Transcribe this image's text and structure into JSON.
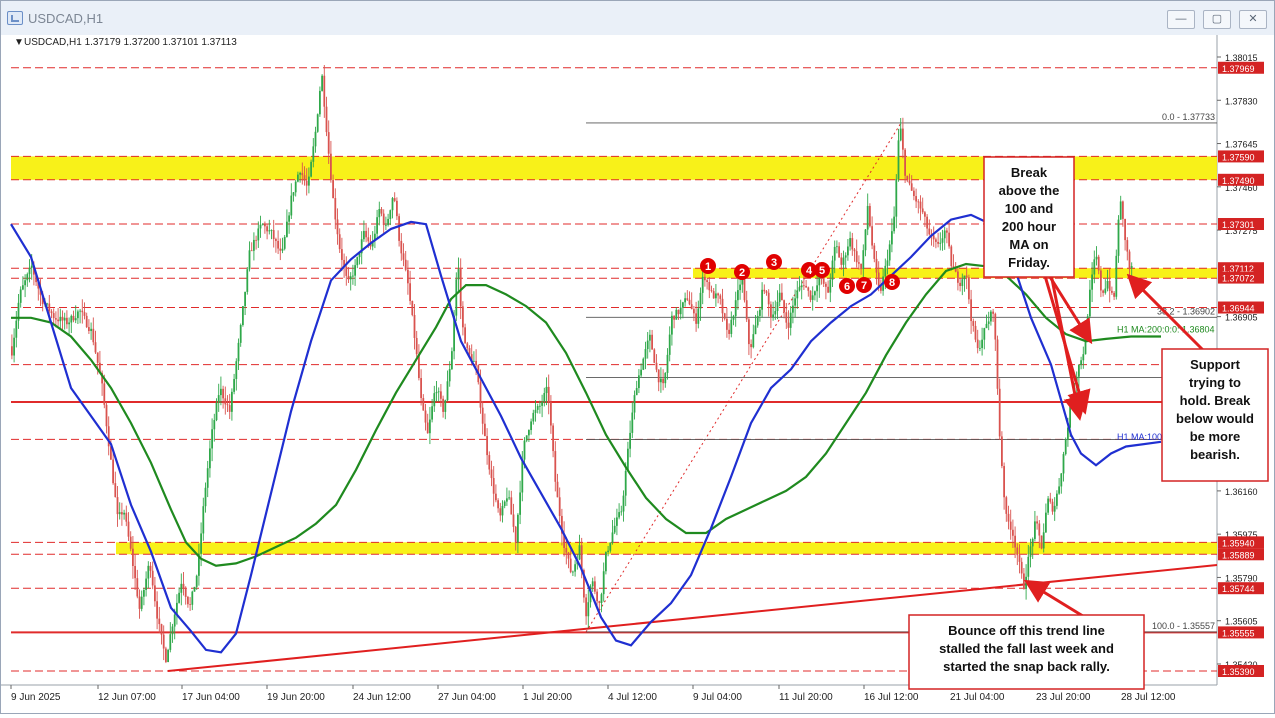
{
  "window": {
    "title": "USDCAD,H1",
    "buttons": {
      "minimize": "—",
      "restore": "▢",
      "close": "✕"
    }
  },
  "chart_data": {
    "type": "candlestick",
    "symbol_header": "USDCAD,H1  1.37179 1.37200 1.37101 1.37113",
    "ylim": [
      1.3539,
      1.38015
    ],
    "price_ticks": [
      "1.38015",
      "1.37830",
      "1.37645",
      "1.37460",
      "1.37275",
      "1.36905",
      "1.36160",
      "1.35975",
      "1.35790",
      "1.35605",
      "1.35420"
    ],
    "x_ticks": [
      "9 Jun 2025",
      "12 Jun 07:00",
      "17 Jun 04:00",
      "19 Jun 20:00",
      "24 Jun 12:00",
      "27 Jun 04:00",
      "1 Jul 20:00",
      "4 Jul 12:00",
      "9 Jul 04:00",
      "11 Jul 20:00",
      "16 Jul 12:00",
      "21 Jul 04:00",
      "23 Jul 20:00",
      "28 Jul 12:00"
    ],
    "price_path": [
      [
        0,
        1.3692
      ],
      [
        12,
        1.3675
      ],
      [
        20,
        1.37
      ],
      [
        32,
        1.3712
      ],
      [
        42,
        1.3698
      ],
      [
        55,
        1.369
      ],
      [
        68,
        1.3688
      ],
      [
        80,
        1.3693
      ],
      [
        92,
        1.3684
      ],
      [
        102,
        1.3662
      ],
      [
        110,
        1.3633
      ],
      [
        118,
        1.3604
      ],
      [
        124,
        1.3608
      ],
      [
        132,
        1.3588
      ],
      [
        140,
        1.3565
      ],
      [
        150,
        1.3586
      ],
      [
        158,
        1.3561
      ],
      [
        166,
        1.3544
      ],
      [
        174,
        1.3562
      ],
      [
        182,
        1.3578
      ],
      [
        190,
        1.3566
      ],
      [
        198,
        1.3582
      ],
      [
        205,
        1.3615
      ],
      [
        212,
        1.364
      ],
      [
        220,
        1.366
      ],
      [
        230,
        1.365
      ],
      [
        240,
        1.3682
      ],
      [
        250,
        1.3718
      ],
      [
        262,
        1.373
      ],
      [
        272,
        1.3726
      ],
      [
        282,
        1.3716
      ],
      [
        292,
        1.3742
      ],
      [
        300,
        1.3754
      ],
      [
        308,
        1.3745
      ],
      [
        316,
        1.377
      ],
      [
        322,
        1.3795
      ],
      [
        328,
        1.3765
      ],
      [
        334,
        1.3738
      ],
      [
        340,
        1.372
      ],
      [
        348,
        1.3704
      ],
      [
        356,
        1.3712
      ],
      [
        364,
        1.3726
      ],
      [
        372,
        1.372
      ],
      [
        380,
        1.3737
      ],
      [
        386,
        1.3728
      ],
      [
        394,
        1.3744
      ],
      [
        400,
        1.3722
      ],
      [
        408,
        1.3705
      ],
      [
        416,
        1.3678
      ],
      [
        422,
        1.3652
      ],
      [
        428,
        1.364
      ],
      [
        436,
        1.3661
      ],
      [
        444,
        1.365
      ],
      [
        452,
        1.3675
      ],
      [
        458,
        1.3716
      ],
      [
        462,
        1.3688
      ],
      [
        468,
        1.3675
      ],
      [
        476,
        1.367
      ],
      [
        484,
        1.3642
      ],
      [
        492,
        1.362
      ],
      [
        500,
        1.3604
      ],
      [
        508,
        1.3615
      ],
      [
        516,
        1.3595
      ],
      [
        524,
        1.3635
      ],
      [
        532,
        1.3648
      ],
      [
        540,
        1.3652
      ],
      [
        548,
        1.366
      ],
      [
        556,
        1.3618
      ],
      [
        564,
        1.3594
      ],
      [
        572,
        1.358
      ],
      [
        580,
        1.3592
      ],
      [
        586,
        1.3563
      ],
      [
        592,
        1.3578
      ],
      [
        600,
        1.3567
      ],
      [
        606,
        1.3588
      ],
      [
        614,
        1.36
      ],
      [
        622,
        1.3608
      ],
      [
        630,
        1.364
      ],
      [
        636,
        1.366
      ],
      [
        642,
        1.367
      ],
      [
        650,
        1.3682
      ],
      [
        658,
        1.3665
      ],
      [
        664,
        1.366
      ],
      [
        672,
        1.369
      ],
      [
        680,
        1.3693
      ],
      [
        688,
        1.3699
      ],
      [
        696,
        1.3688
      ],
      [
        704,
        1.3709
      ],
      [
        712,
        1.37
      ],
      [
        720,
        1.3698
      ],
      [
        728,
        1.3682
      ],
      [
        736,
        1.3696
      ],
      [
        742,
        1.3708
      ],
      [
        750,
        1.3676
      ],
      [
        758,
        1.369
      ],
      [
        764,
        1.3704
      ],
      [
        772,
        1.369
      ],
      [
        780,
        1.37
      ],
      [
        788,
        1.3686
      ],
      [
        796,
        1.37
      ],
      [
        804,
        1.3705
      ],
      [
        812,
        1.3698
      ],
      [
        820,
        1.3709
      ],
      [
        828,
        1.37
      ],
      [
        836,
        1.3722
      ],
      [
        842,
        1.3712
      ],
      [
        850,
        1.3724
      ],
      [
        856,
        1.3716
      ],
      [
        862,
        1.371
      ],
      [
        868,
        1.3738
      ],
      [
        874,
        1.3715
      ],
      [
        880,
        1.37
      ],
      [
        886,
        1.3712
      ],
      [
        894,
        1.373
      ],
      [
        900,
        1.3774
      ],
      [
        906,
        1.375
      ],
      [
        914,
        1.3742
      ],
      [
        922,
        1.3736
      ],
      [
        930,
        1.3725
      ],
      [
        938,
        1.372
      ],
      [
        946,
        1.3728
      ],
      [
        952,
        1.3712
      ],
      [
        960,
        1.3705
      ],
      [
        966,
        1.371
      ],
      [
        972,
        1.3688
      ],
      [
        978,
        1.3676
      ],
      [
        986,
        1.3686
      ],
      [
        994,
        1.3694
      ],
      [
        1000,
        1.364
      ],
      [
        1006,
        1.3605
      ],
      [
        1012,
        1.36
      ],
      [
        1018,
        1.3588
      ],
      [
        1024,
        1.3575
      ],
      [
        1030,
        1.359
      ],
      [
        1036,
        1.3603
      ],
      [
        1042,
        1.3592
      ],
      [
        1048,
        1.3612
      ],
      [
        1054,
        1.3608
      ],
      [
        1060,
        1.362
      ],
      [
        1066,
        1.3638
      ],
      [
        1072,
        1.3655
      ],
      [
        1078,
        1.3668
      ],
      [
        1084,
        1.3676
      ],
      [
        1090,
        1.37
      ],
      [
        1096,
        1.3718
      ],
      [
        1102,
        1.37
      ],
      [
        1108,
        1.3706
      ],
      [
        1114,
        1.3696
      ],
      [
        1120,
        1.3742
      ],
      [
        1126,
        1.3722
      ],
      [
        1130,
        1.3711
      ]
    ],
    "ma100_path": [
      [
        10,
        1.373
      ],
      [
        30,
        1.3716
      ],
      [
        50,
        1.3688
      ],
      [
        70,
        1.366
      ],
      [
        90,
        1.3648
      ],
      [
        110,
        1.3636
      ],
      [
        130,
        1.361
      ],
      [
        150,
        1.359
      ],
      [
        170,
        1.3566
      ],
      [
        190,
        1.3556
      ],
      [
        205,
        1.3548
      ],
      [
        220,
        1.3547
      ],
      [
        235,
        1.3555
      ],
      [
        250,
        1.358
      ],
      [
        270,
        1.3615
      ],
      [
        290,
        1.365
      ],
      [
        310,
        1.368
      ],
      [
        330,
        1.3706
      ],
      [
        350,
        1.3715
      ],
      [
        370,
        1.3722
      ],
      [
        390,
        1.3728
      ],
      [
        410,
        1.3731
      ],
      [
        425,
        1.373
      ],
      [
        440,
        1.3708
      ],
      [
        460,
        1.368
      ],
      [
        480,
        1.3664
      ],
      [
        500,
        1.3648
      ],
      [
        520,
        1.363
      ],
      [
        540,
        1.3615
      ],
      [
        560,
        1.36
      ],
      [
        580,
        1.3583
      ],
      [
        600,
        1.3562
      ],
      [
        615,
        1.3552
      ],
      [
        630,
        1.355
      ],
      [
        650,
        1.356
      ],
      [
        670,
        1.3568
      ],
      [
        690,
        1.358
      ],
      [
        710,
        1.36
      ],
      [
        730,
        1.3622
      ],
      [
        750,
        1.3645
      ],
      [
        770,
        1.366
      ],
      [
        790,
        1.3668
      ],
      [
        810,
        1.368
      ],
      [
        830,
        1.3688
      ],
      [
        850,
        1.3695
      ],
      [
        870,
        1.37
      ],
      [
        890,
        1.3708
      ],
      [
        910,
        1.3716
      ],
      [
        930,
        1.3725
      ],
      [
        950,
        1.3732
      ],
      [
        970,
        1.3734
      ],
      [
        990,
        1.373
      ],
      [
        1010,
        1.3716
      ],
      [
        1030,
        1.369
      ],
      [
        1050,
        1.367
      ],
      [
        1070,
        1.364
      ],
      [
        1080,
        1.3632
      ],
      [
        1095,
        1.3627
      ],
      [
        1110,
        1.3632
      ],
      [
        1125,
        1.3635
      ],
      [
        1160,
        1.3637
      ]
    ],
    "ma200_path": [
      [
        10,
        1.369
      ],
      [
        30,
        1.369
      ],
      [
        50,
        1.3688
      ],
      [
        70,
        1.3682
      ],
      [
        90,
        1.3672
      ],
      [
        110,
        1.366
      ],
      [
        130,
        1.3645
      ],
      [
        150,
        1.3628
      ],
      [
        170,
        1.3608
      ],
      [
        185,
        1.3594
      ],
      [
        200,
        1.3587
      ],
      [
        215,
        1.3584
      ],
      [
        235,
        1.3585
      ],
      [
        255,
        1.3588
      ],
      [
        275,
        1.3592
      ],
      [
        295,
        1.3596
      ],
      [
        315,
        1.3602
      ],
      [
        335,
        1.361
      ],
      [
        355,
        1.3625
      ],
      [
        375,
        1.3642
      ],
      [
        395,
        1.3658
      ],
      [
        415,
        1.3672
      ],
      [
        435,
        1.3686
      ],
      [
        450,
        1.3698
      ],
      [
        465,
        1.3704
      ],
      [
        485,
        1.3704
      ],
      [
        505,
        1.37
      ],
      [
        525,
        1.3695
      ],
      [
        545,
        1.3688
      ],
      [
        565,
        1.3675
      ],
      [
        585,
        1.3658
      ],
      [
        605,
        1.364
      ],
      [
        625,
        1.3626
      ],
      [
        645,
        1.3613
      ],
      [
        665,
        1.3604
      ],
      [
        685,
        1.3598
      ],
      [
        705,
        1.3598
      ],
      [
        725,
        1.3604
      ],
      [
        745,
        1.3608
      ],
      [
        765,
        1.3612
      ],
      [
        785,
        1.3616
      ],
      [
        805,
        1.3622
      ],
      [
        825,
        1.3632
      ],
      [
        845,
        1.3645
      ],
      [
        865,
        1.3658
      ],
      [
        885,
        1.3674
      ],
      [
        905,
        1.3688
      ],
      [
        925,
        1.37
      ],
      [
        945,
        1.371
      ],
      [
        965,
        1.3713
      ],
      [
        985,
        1.3712
      ],
      [
        1005,
        1.3708
      ],
      [
        1025,
        1.37
      ],
      [
        1045,
        1.369
      ],
      [
        1065,
        1.3683
      ],
      [
        1085,
        1.368
      ],
      [
        1105,
        1.3681
      ],
      [
        1130,
        1.3682
      ],
      [
        1160,
        1.3682
      ]
    ],
    "zones": [
      {
        "lo": 1.3749,
        "hi": 1.3759
      },
      {
        "lo": 1.37072,
        "hi": 1.37112
      },
      {
        "lo": 1.35889,
        "hi": 1.3594
      }
    ],
    "hlines": [
      {
        "price": 1.37969,
        "style": "dashed-red"
      },
      {
        "price": 1.37301,
        "style": "dashed-red"
      },
      {
        "price": 1.36944,
        "style": "dashed-red"
      },
      {
        "price": 1.367,
        "style": "dashed-red"
      },
      {
        "price": 1.3638,
        "style": "dashed-red"
      },
      {
        "price": 1.35744,
        "style": "dashed-red"
      },
      {
        "price": 1.3539,
        "style": "dashed-red"
      },
      {
        "price": 1.3654,
        "style": "solid-red"
      },
      {
        "price": 1.35555,
        "style": "solid-red"
      }
    ],
    "fibonacci": {
      "levels": [
        {
          "price": 1.37733,
          "label": "0.0 - 1.37733"
        },
        {
          "price": 1.36902,
          "label": "38.2 - 1.36902"
        },
        {
          "price": 1.36645,
          "label": ""
        },
        {
          "price": 1.3638,
          "label": ""
        },
        {
          "price": 1.35557,
          "label": "100.0 - 1.35557"
        }
      ]
    },
    "price_labels": [
      {
        "price": 1.37969,
        "text": "1.37969",
        "color": "#d42323"
      },
      {
        "price": 1.3759,
        "text": "1.37590",
        "color": "#d42323"
      },
      {
        "price": 1.3749,
        "text": "1.37490",
        "color": "#d42323"
      },
      {
        "price": 1.37301,
        "text": "1.37301",
        "color": "#d42323"
      },
      {
        "price": 1.37112,
        "text": "1.37112",
        "color": "#d42323"
      },
      {
        "price": 1.37072,
        "text": "1.37072",
        "color": "#d42323"
      },
      {
        "price": 1.36944,
        "text": "1.36944",
        "color": "#d42323"
      },
      {
        "price": 1.3594,
        "text": "1.35940",
        "color": "#d42323"
      },
      {
        "price": 1.35889,
        "text": "1.35889",
        "color": "#d42323"
      },
      {
        "price": 1.35744,
        "text": "1.35744",
        "color": "#d42323"
      },
      {
        "price": 1.35555,
        "text": "1.35555",
        "color": "#d42323"
      },
      {
        "price": 1.3539,
        "text": "1.35390",
        "color": "#d42323"
      }
    ],
    "ma_labels": {
      "ma200": "H1 MA:200:0:0: 1.36804",
      "ma100": "H1 MA:100"
    },
    "test_markers": [
      "1",
      "2",
      "3",
      "4",
      "5",
      "6",
      "7",
      "8"
    ],
    "annotations": {
      "break_box": "Break above the 100 and 200 hour MA on Friday.",
      "support_box": "Support trying to hold. Break below would be more bearish.",
      "bounce_box": "Bounce off this trend line stalled the fall last week and started the snap back rally."
    },
    "colors": {
      "bull": "#2fa84a",
      "bear": "#d9534f",
      "ma100": "#1f2fd1",
      "ma200": "#1f8a1f",
      "zone": "#f7f000",
      "level": "#e02b2b",
      "fib": "#555555"
    },
    "grid": false
  }
}
